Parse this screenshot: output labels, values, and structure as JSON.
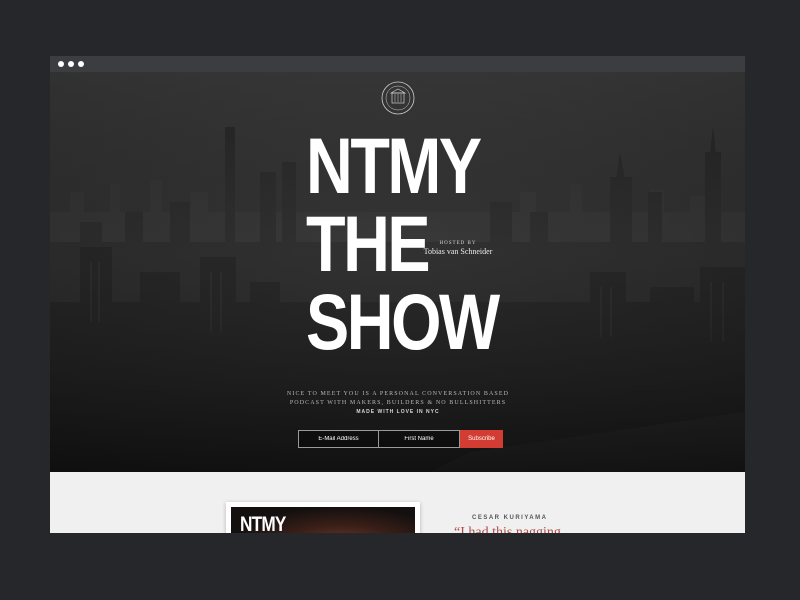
{
  "colors": {
    "background": "#26272b",
    "titlebar": "#3c3d41",
    "accent": "#d23c33",
    "quote": "#b04a42"
  },
  "emblem": {
    "icon": "badge-emblem-icon"
  },
  "hero": {
    "title_lines": [
      "NTMY",
      "THE",
      "SHOW"
    ],
    "hosted_by": "HOSTED BY",
    "host_name": "Tobias van Schneider",
    "tagline_line1": "NICE TO MEET YOU IS A PERSONAL CONVERSATION BASED",
    "tagline_line2": "PODCAST WITH MAKERS, BUILDERS & NO BULLSHITTERS",
    "made_with": "MADE WITH LOVE IN NYC"
  },
  "signup": {
    "email_placeholder": "E-Mail Address",
    "first_name_placeholder": "First Name",
    "subscribe_label": "Subscribe"
  },
  "episode": {
    "cover_title": "NTMY",
    "guest_name": "CESAR KURIYAMA",
    "quote": "“I had this nagging"
  }
}
